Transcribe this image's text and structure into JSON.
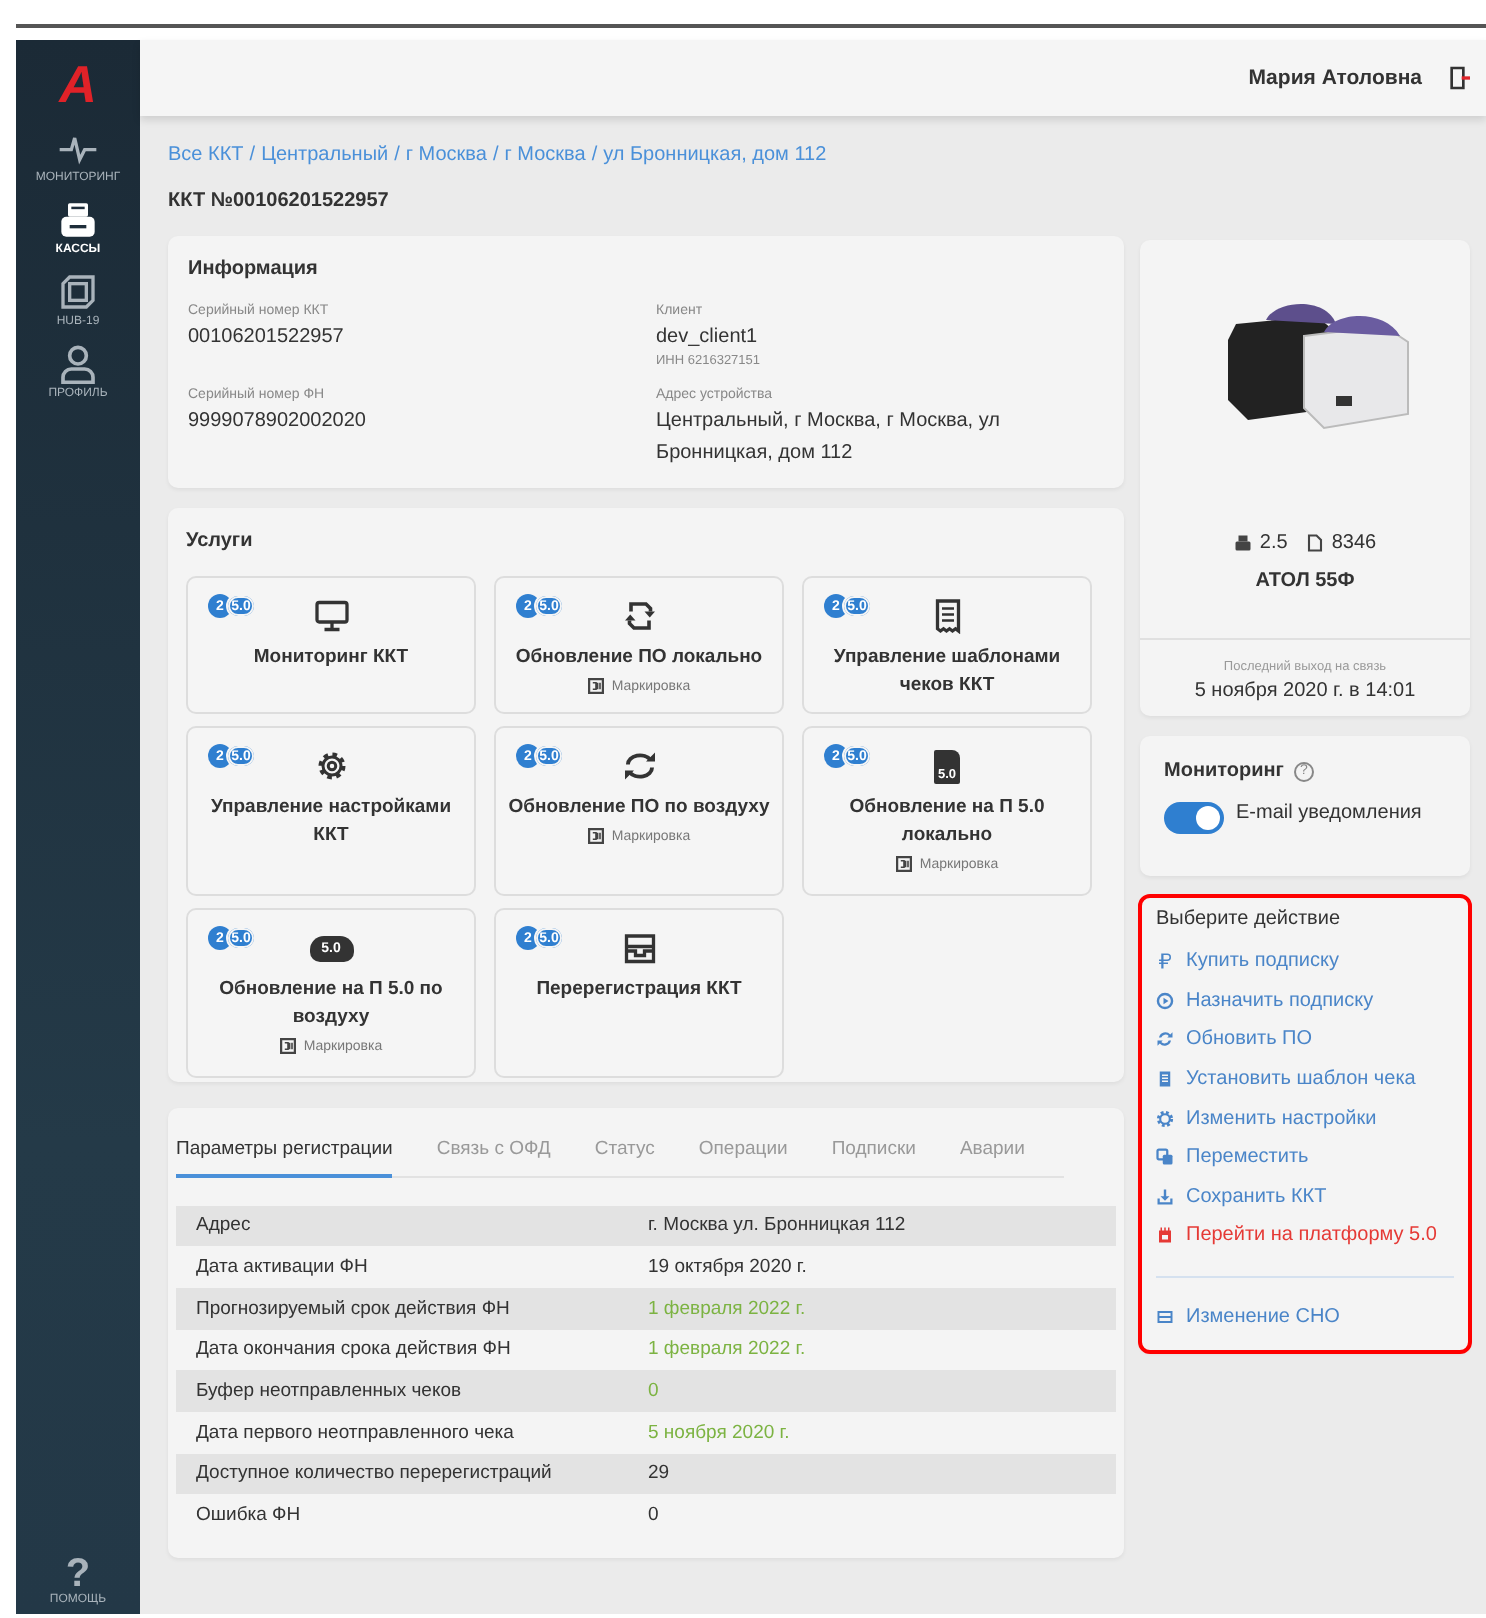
{
  "sidebar": {
    "logo": "A",
    "items": [
      {
        "label": "МОНИТОРИНГ",
        "kind": "pulse",
        "selected": false
      },
      {
        "label": "КАССЫ",
        "kind": "printer",
        "selected": true
      },
      {
        "label": "HUB-19",
        "kind": "hub",
        "selected": false
      },
      {
        "label": "ПРОФИЛЬ",
        "kind": "user",
        "selected": false
      }
    ],
    "help": {
      "label": "ПОМОЩЬ",
      "icon": "?"
    }
  },
  "header": {
    "user": "Мария Атоловна"
  },
  "breadcrumbs": {
    "separator": "/",
    "items": [
      "Все ККТ",
      "Центральный",
      "г Москва",
      "г Москва",
      "ул Бронницкая, дом 112"
    ]
  },
  "page_title": "ККТ №00106201522957",
  "info": {
    "title": "Информация",
    "fields": [
      {
        "label": "Серийный номер ККТ",
        "value": "00106201522957"
      },
      {
        "label": "Клиент",
        "value": "dev_client1",
        "note": "ИНН 6216327151"
      },
      {
        "label": "Серийный номер ФН",
        "value": "9999078902002020"
      },
      {
        "label": "Адрес устройства",
        "value": "Центральный, г Москва, г Москва, ул Бронницкая, дом 112"
      }
    ]
  },
  "services": {
    "title": "Услуги",
    "cards": [
      {
        "badge": [
          "2",
          "5.0"
        ],
        "kind": "monitor",
        "title": "Мониторинг ККТ"
      },
      {
        "badge": [
          "2",
          "5.0"
        ],
        "kind": "sync-local",
        "title": "Обновление ПО локально",
        "tag": "Маркировка"
      },
      {
        "badge": [
          "2",
          "5.0"
        ],
        "kind": "receipt",
        "title": "Управление шаблонами чеков ККТ"
      },
      {
        "badge": [
          "2",
          "5.0"
        ],
        "kind": "gear",
        "title": "Управление настройками ККТ"
      },
      {
        "badge": [
          "2",
          "5.0"
        ],
        "kind": "sync-air",
        "title": "Обновление ПО по воздуху",
        "tag": "Маркировка"
      },
      {
        "badge": [
          "2",
          "5.0"
        ],
        "kind": "sim",
        "icon_text": "5.0",
        "title": "Обновление на П 5.0 локально",
        "tag": "Маркировка"
      },
      {
        "badge": [
          "2",
          "5.0"
        ],
        "kind": "cloud",
        "icon_text": "5.0",
        "title": "Обновление на П 5.0 по воздуху",
        "tag": "Маркировка"
      },
      {
        "badge": [
          "2",
          "5.0"
        ],
        "kind": "tray",
        "title": "Перерегистрация ККТ"
      }
    ]
  },
  "registration": {
    "tabs": [
      {
        "label": "Параметры регистрации",
        "selected": true
      },
      {
        "label": "Связь с ОФД",
        "selected": false
      },
      {
        "label": "Статус",
        "selected": false
      },
      {
        "label": "Операции",
        "selected": false
      },
      {
        "label": "Подписки",
        "selected": false
      },
      {
        "label": "Аварии",
        "selected": false
      }
    ],
    "rows": [
      {
        "name": "Адрес",
        "value": "г. Москва ул. Бронницкая 112",
        "positive": false
      },
      {
        "name": "Дата активации ФН",
        "value": "19 октября 2020 г.",
        "positive": false
      },
      {
        "name": "Прогнозируемый срок действия ФН",
        "value": "1 февраля 2022 г.",
        "positive": true
      },
      {
        "name": "Дата окончания срока действия ФН",
        "value": "1 февраля 2022 г.",
        "positive": true
      },
      {
        "name": "Буфер неотправленных чеков",
        "value": "0",
        "positive": true
      },
      {
        "name": "Дата первого неотправленного чека",
        "value": "5 ноября 2020 г.",
        "positive": true
      },
      {
        "name": "Доступное количество перерегистраций",
        "value": "29",
        "positive": false
      },
      {
        "name": "Ошибка ФН",
        "value": "0",
        "positive": false
      }
    ]
  },
  "device": {
    "version": "2.5",
    "docs": "8346",
    "model": "АТОЛ 55Ф",
    "last_seen_label": "Последний выход на связь",
    "last_seen": "5 ноября 2020 г. в 14:01"
  },
  "monitoring": {
    "title": "Мониторинг",
    "help": "?",
    "toggle": {
      "label": "E-mail уведомления",
      "on": true
    }
  },
  "actions": {
    "title": "Выберите действие",
    "highlighted": true,
    "items": [
      {
        "label": "Купить подписку",
        "kind": "ruble",
        "alert": false
      },
      {
        "label": "Назначить подписку",
        "kind": "play",
        "alert": false
      },
      {
        "label": "Обновить ПО",
        "kind": "sync",
        "alert": false
      },
      {
        "label": "Установить шаблон чека",
        "kind": "receipt",
        "alert": false
      },
      {
        "label": "Изменить настройки",
        "kind": "gear",
        "alert": false
      },
      {
        "label": "Переместить",
        "kind": "move",
        "alert": false
      },
      {
        "label": "Сохранить ККТ",
        "kind": "download",
        "alert": false
      },
      {
        "label": "Перейти на платформу 5.0",
        "kind": "chip",
        "alert": true
      }
    ],
    "footer": {
      "label": "Изменение СНО",
      "kind": "tray",
      "alert": false
    }
  }
}
